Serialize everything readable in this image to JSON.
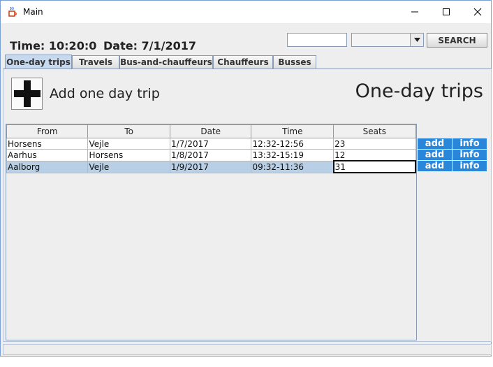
{
  "window": {
    "title": "Main",
    "icons": {
      "app": "java-cup-icon",
      "minimize": "minimize-icon",
      "maximize": "maximize-icon",
      "close": "close-icon"
    }
  },
  "header": {
    "time_text": "Time: 10:20:0",
    "date_text": "Date: 7/1/2017"
  },
  "search": {
    "input_value": "",
    "combo_value": "",
    "button_label": "SEARCH"
  },
  "tabs": [
    {
      "label": "One-day trips",
      "active": true
    },
    {
      "label": "Travels",
      "active": false
    },
    {
      "label": "Bus-and-chauffeurs",
      "active": false
    },
    {
      "label": "Chauffeurs",
      "active": false
    },
    {
      "label": "Busses",
      "active": false
    }
  ],
  "main": {
    "add_label": "Add one day trip",
    "title": "One-day trips",
    "columns": [
      "From",
      "To",
      "Date",
      "Time",
      "Seats"
    ],
    "rows": [
      {
        "from": "Horsens",
        "to": "Vejle",
        "date": "1/7/2017",
        "time": "12:32-12:56",
        "seats": "23"
      },
      {
        "from": "Aarhus",
        "to": "Horsens",
        "date": "1/8/2017",
        "time": "13:32-15:19",
        "seats": "12"
      },
      {
        "from": "Aalborg",
        "to": "Vejle",
        "date": "1/9/2017",
        "time": "09:32-11:36",
        "seats": "31"
      }
    ],
    "selected_row": 2,
    "row_actions": {
      "add_label": "add",
      "info_label": "info"
    }
  },
  "colors": {
    "accent_button": "#2a86d8",
    "selected_row": "#b8cfe5",
    "active_tab": "#c7d9ee"
  }
}
